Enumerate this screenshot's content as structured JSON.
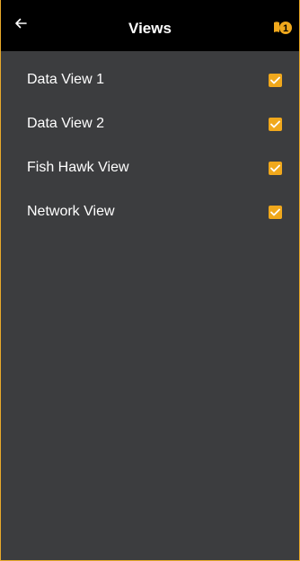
{
  "header": {
    "title": "Views",
    "back_icon": "arrow-left-icon",
    "notification_icon": "alert-badge-icon",
    "notification_count": "1"
  },
  "views": [
    {
      "label": "Data View 1",
      "checked": true
    },
    {
      "label": "Data View 2",
      "checked": true
    },
    {
      "label": "Fish Hawk View",
      "checked": true
    },
    {
      "label": "Network View",
      "checked": true
    }
  ],
  "colors": {
    "accent": "#f0a81c",
    "background": "#3c3d3f",
    "header": "#000000",
    "text": "#ffffff"
  }
}
